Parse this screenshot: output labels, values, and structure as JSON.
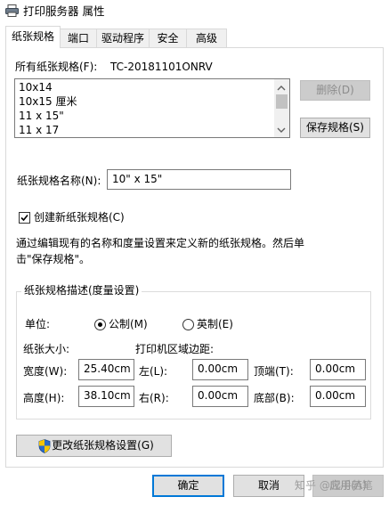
{
  "window": {
    "title": "打印服务器 属性"
  },
  "tabs": [
    "纸张规格",
    "端口",
    "驱动程序",
    "安全",
    "高级"
  ],
  "forms": {
    "all_forms_label": "所有纸张规格(F):",
    "server_name": "TC-20181101ONRV",
    "list_items": [
      "10x14",
      "10x15 厘米",
      "11 x 15\"",
      "11 x 17"
    ],
    "delete_button": "删除(D)",
    "save_button": "保存规格(S)",
    "form_name_label": "纸张规格名称(N):",
    "form_name_value": "10\" x 15\"",
    "create_new_label": "创建新纸张规格(C)",
    "create_new_checked": true,
    "description_line1": "通过编辑现有的名称和度量设置来定义新的纸张规格。然后单",
    "description_line2": "击\"保存规格\"。"
  },
  "measurements": {
    "group_title": "纸张规格描述(度量设置)",
    "units_label": "单位:",
    "metric_label": "公制(M)",
    "english_label": "英制(E)",
    "selected_unit": "metric",
    "paper_size_label": "纸张大小:",
    "margins_label": "打印机区域边距:",
    "width_label": "宽度(W):",
    "width_value": "25.40cm",
    "height_label": "高度(H):",
    "height_value": "38.10cm",
    "left_label": "左(L):",
    "left_value": "0.00cm",
    "right_label": "右(R):",
    "right_value": "0.00cm",
    "top_label": "顶端(T):",
    "top_value": "0.00cm",
    "bottom_label": "底部(B):",
    "bottom_value": "0.00cm"
  },
  "change_settings_button": "更改纸张规格设置(G)",
  "dialog_buttons": {
    "ok": "确定",
    "cancel": "取消",
    "apply": "应用(A)"
  },
  "watermark": "知乎 @起手若笔",
  "colors": {
    "accent": "#0078d7",
    "disabled_text": "#8c8c8c",
    "button_face": "#e1e1e1"
  }
}
